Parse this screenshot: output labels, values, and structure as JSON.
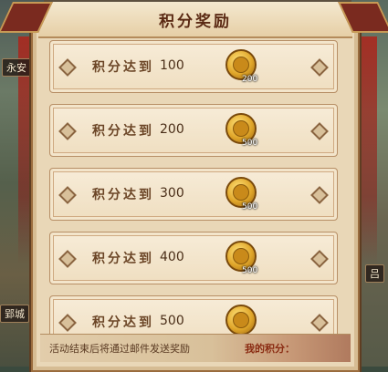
{
  "map": {
    "city_labels": [
      "永安",
      "郢城",
      "吕"
    ],
    "left_edge_glyph": "永",
    "right_edge_glyph": "吕"
  },
  "dialog": {
    "title": "积分奖励",
    "rows": [
      {
        "label": "积分达到",
        "value": "100",
        "reward_qty": "200"
      },
      {
        "label": "积分达到",
        "value": "200",
        "reward_qty": "500"
      },
      {
        "label": "积分达到",
        "value": "300",
        "reward_qty": "500"
      },
      {
        "label": "积分达到",
        "value": "400",
        "reward_qty": "500"
      },
      {
        "label": "积分达到",
        "value": "500",
        "reward_qty": ""
      }
    ],
    "reward_icon": "gold-tiger-coin-icon",
    "footer_note": "活动结束后将通过邮件发送奖励",
    "my_score_label": "我的积分："
  },
  "colors": {
    "panel_bg": "#e9d7b7",
    "title_text": "#5b2a14",
    "accent_red": "#7a2a1f",
    "coin_gold": "#e0a62a"
  }
}
